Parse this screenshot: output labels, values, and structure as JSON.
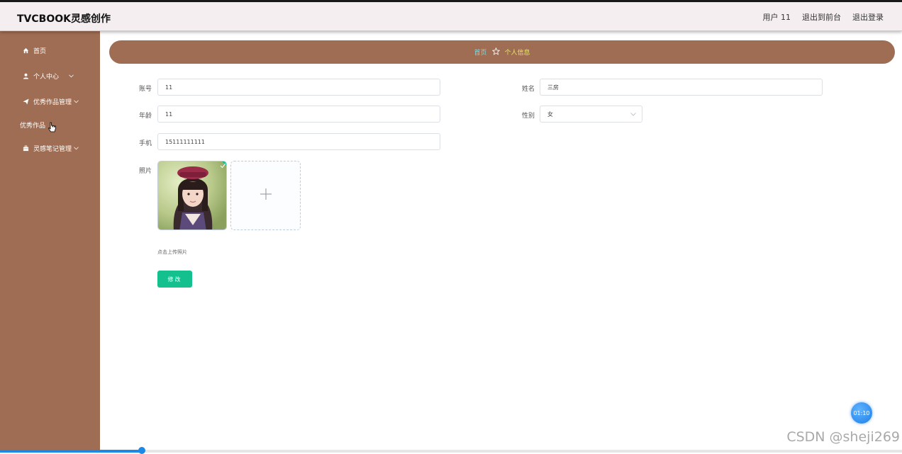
{
  "header": {
    "title": "TVCBOOK灵感创作",
    "user_label": "用户 11",
    "back_to_front": "退出到前台",
    "logout": "退出登录"
  },
  "sidebar": {
    "items": [
      {
        "label": "首页",
        "icon": "home-icon"
      },
      {
        "label": "个人中心",
        "icon": "user-icon"
      },
      {
        "label": "优秀作品管理",
        "icon": "paper-plane-icon"
      },
      {
        "label": "优秀作品",
        "icon": ""
      },
      {
        "label": "灵感笔记管理",
        "icon": "briefcase-icon"
      }
    ]
  },
  "breadcrumb": {
    "home": "首页",
    "current": "个人信息"
  },
  "form": {
    "account_label": "账号",
    "account_value": "11",
    "name_label": "姓名",
    "name_value": "三房",
    "age_label": "年龄",
    "age_value": "11",
    "gender_label": "性别",
    "gender_value": "女",
    "phone_label": "手机",
    "phone_value": "15111111111",
    "photo_label": "照片",
    "upload_tip": "点击上传照片",
    "submit_label": "修改"
  },
  "overlay": {
    "timer": "01:10",
    "watermark": "CSDN @sheji269",
    "progress": 0.157
  },
  "colors": {
    "sidebar_bg": "#9f6d53",
    "header_bg": "#f5eef0",
    "button": "#13c08e",
    "breadcrumb_home": "#7fd8e0",
    "breadcrumb_current": "#e8e66a"
  }
}
